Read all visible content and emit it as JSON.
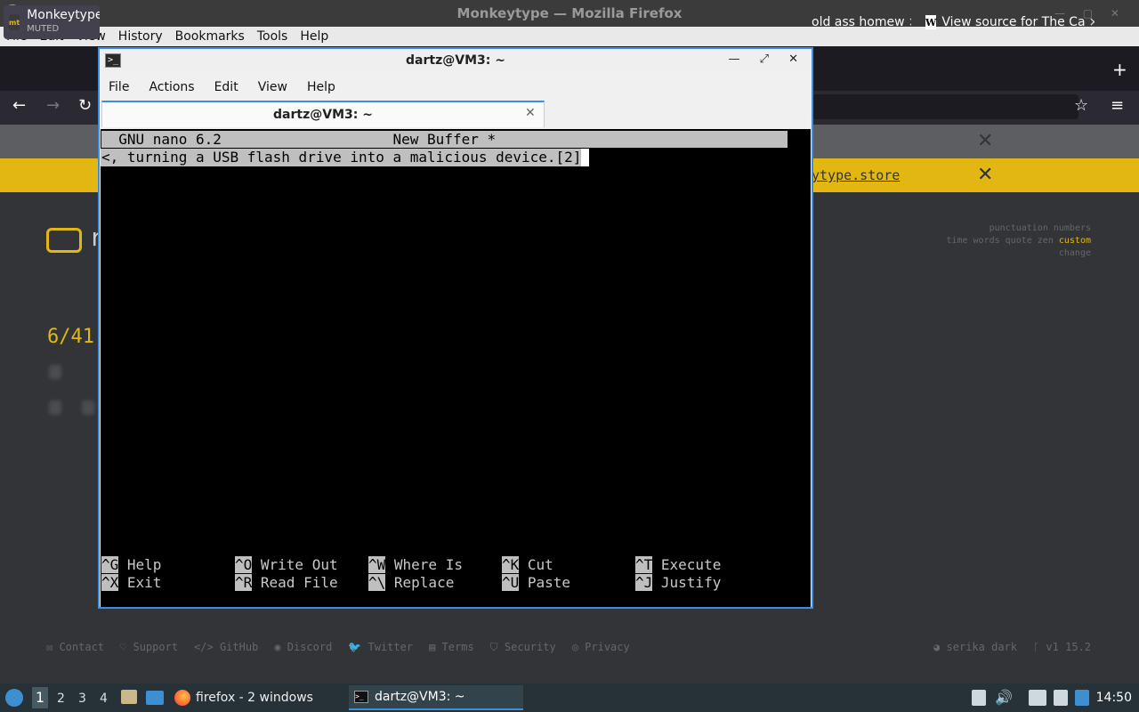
{
  "firefox": {
    "window_title": "Monkeytype — Mozilla Firefox",
    "menu": [
      "File",
      "Edit",
      "View",
      "History",
      "Bookmarks",
      "Tools",
      "Help"
    ],
    "tabs": [
      {
        "title": "Monkeytype",
        "subtitle": "MUTED",
        "favicon": "mt"
      },
      {
        "title": "old ass homew",
        "close": "×"
      },
      {
        "title": "View source for The Ca",
        "close": "×",
        "favicon": "W"
      }
    ],
    "new_tab": "+"
  },
  "monkeytype": {
    "store_link": "ytype.store",
    "logo_letter": "r",
    "config": {
      "row1": "punctuation numbers",
      "row2_prefix": "time words quote zen ",
      "row2_active": "custom",
      "row3": "change"
    },
    "word_count": "6/41",
    "footer_left": [
      "✉ Contact",
      "♡ Support",
      "</> GitHub",
      "◉ Discord",
      "🐦 Twitter",
      "▤ Terms",
      "⛉ Security",
      "◎ Privacy"
    ],
    "footer_right": [
      "◕ serika dark",
      "ᚴ v1 15.2"
    ]
  },
  "terminal": {
    "title": "dartz@VM3: ~",
    "menu": [
      "File",
      "Actions",
      "Edit",
      "View",
      "Help"
    ],
    "tab_title": "dartz@VM3: ~",
    "nano_header": "  GNU nano 6.2                    New Buffer *",
    "nano_line": "<, turning a USB flash drive into a malicious device.[2]",
    "shortcuts": [
      {
        "key": "^G",
        "label": " Help"
      },
      {
        "key": "^O",
        "label": " Write Out"
      },
      {
        "key": "^W",
        "label": " Where Is"
      },
      {
        "key": "^K",
        "label": " Cut"
      },
      {
        "key": "^T",
        "label": " Execute"
      },
      {
        "key": "^X",
        "label": " Exit"
      },
      {
        "key": "^R",
        "label": " Read File"
      },
      {
        "key": "^\\",
        "label": " Replace"
      },
      {
        "key": "^U",
        "label": " Paste"
      },
      {
        "key": "^J",
        "label": " Justify"
      }
    ]
  },
  "taskbar": {
    "workspaces": [
      "1",
      "2",
      "3",
      "4"
    ],
    "firefox_button": "firefox - 2 windows",
    "terminal_button": "dartz@VM3: ~",
    "clock": "14:50"
  },
  "colors": {
    "accent": "#3a8ee6",
    "monkeytype_yellow": "#e2b714",
    "taskbar": "#263238"
  }
}
